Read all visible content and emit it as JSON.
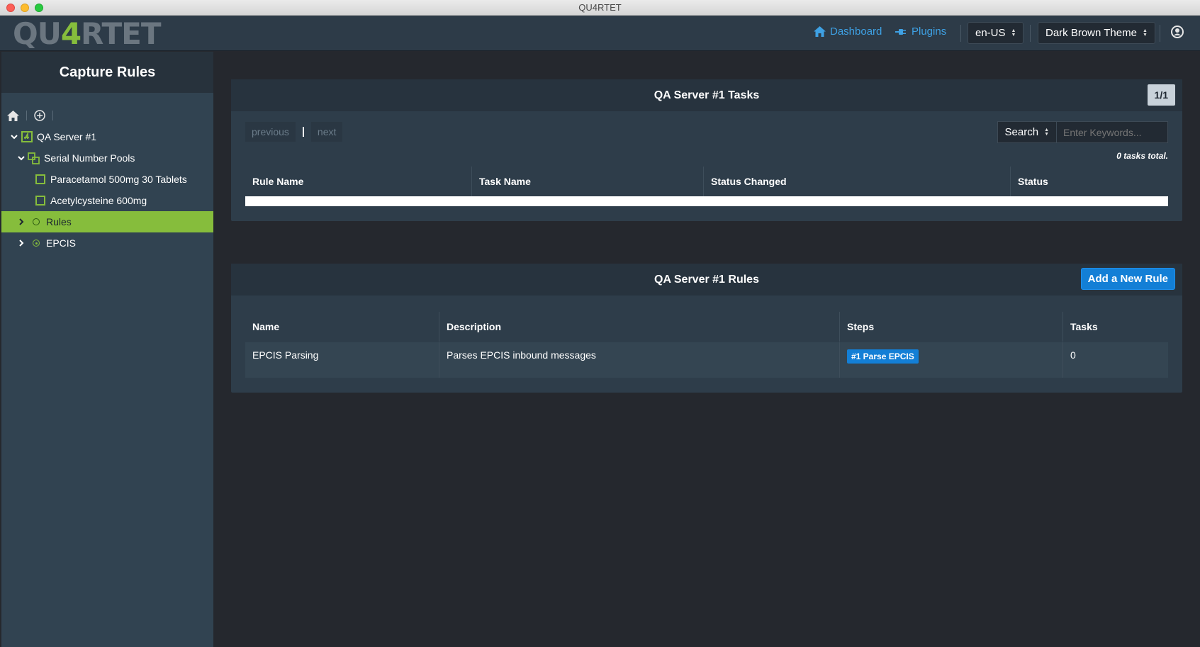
{
  "window": {
    "title": "QU4RTET"
  },
  "logo": {
    "prefix": "QU",
    "four": "4",
    "suffix": "RTET"
  },
  "nav": {
    "dashboard_label": "Dashboard",
    "plugins_label": "Plugins",
    "locale_value": "en-US",
    "theme_value": "Dark Brown Theme"
  },
  "sidebar": {
    "title": "Capture Rules",
    "tree": {
      "server": "QA Server #1",
      "serial_pools": "Serial Number Pools",
      "pool_items": [
        "Paracetamol 500mg 30 Tablets",
        "Acetylcysteine 600mg"
      ],
      "rules": "Rules",
      "epcis": "EPCIS"
    }
  },
  "tasks_panel": {
    "title": "QA Server #1 Tasks",
    "page_indicator": "1/1",
    "previous_label": "previous",
    "next_label": "next",
    "search_label": "Search",
    "search_placeholder": "Enter Keywords...",
    "total_text": "0 tasks total.",
    "columns": [
      "Rule Name",
      "Task Name",
      "Status Changed",
      "Status"
    ]
  },
  "rules_panel": {
    "title": "QA Server #1 Rules",
    "add_button_label": "Add a New Rule",
    "columns": [
      "Name",
      "Description",
      "Steps",
      "Tasks"
    ],
    "rows": [
      {
        "name": "EPCIS Parsing",
        "description": "Parses EPCIS inbound messages",
        "step": "#1 Parse EPCIS",
        "tasks": "0"
      }
    ]
  },
  "colors": {
    "accent_green": "#86bd3c",
    "link_blue": "#3ea1e4",
    "button_blue": "#137fd6",
    "sidebar_bg": "#314351",
    "content_bg": "#25282e"
  }
}
